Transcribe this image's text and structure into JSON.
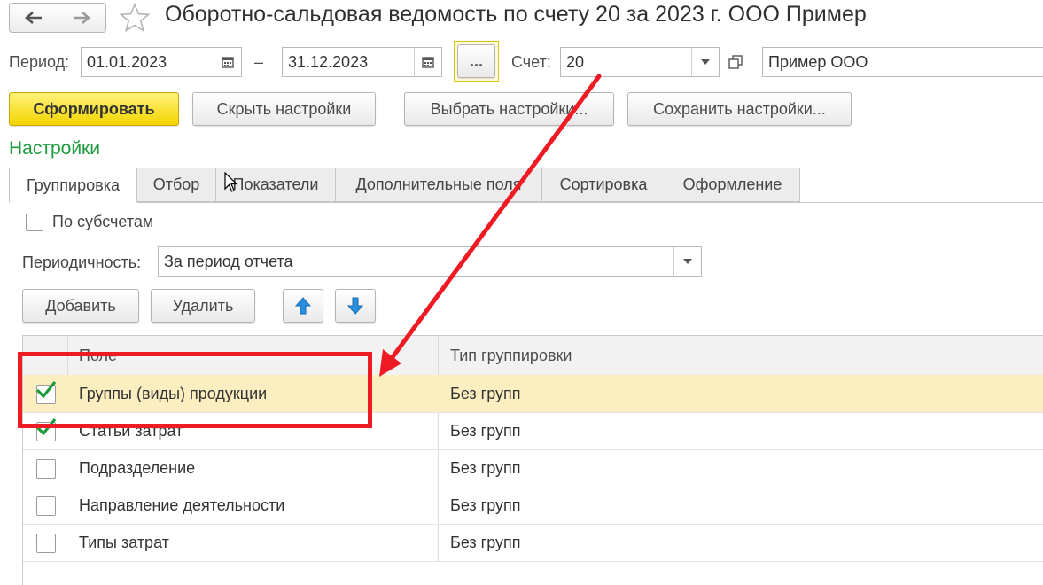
{
  "header": {
    "title": "Оборотно-сальдовая ведомость по счету 20 за 2023 г. ООО Пример"
  },
  "period": {
    "label": "Период:",
    "from": "01.01.2023",
    "dash": "–",
    "to": "31.12.2023",
    "more_label": "..."
  },
  "account": {
    "label": "Счет:",
    "value": "20",
    "org": "Пример ООО"
  },
  "toolbar": {
    "generate": "Сформировать",
    "hide_settings": "Скрыть настройки",
    "choose_settings": "Выбрать настройки...",
    "save_settings": "Сохранить настройки..."
  },
  "settings": {
    "title": "Настройки",
    "tabs": [
      {
        "label": "Группировка"
      },
      {
        "label": "Отбор"
      },
      {
        "label": "Показатели"
      },
      {
        "label": "Дополнительные поля"
      },
      {
        "label": "Сортировка"
      },
      {
        "label": "Оформление"
      }
    ],
    "subaccounts_label": "По субсчетам",
    "periodicity_label": "Периодичность:",
    "periodicity_value": "За период отчета",
    "add": "Добавить",
    "delete": "Удалить"
  },
  "table": {
    "headers": {
      "field": "Поле",
      "type": "Тип группировки"
    },
    "rows": [
      {
        "field": "Группы (виды) продукции",
        "type": "Без групп",
        "checked": true
      },
      {
        "field": "Статьи затрат",
        "type": "Без групп",
        "checked": true
      },
      {
        "field": "Подразделение",
        "type": "Без групп",
        "checked": false
      },
      {
        "field": "Направление деятельности",
        "type": "Без групп",
        "checked": false
      },
      {
        "field": "Типы затрат",
        "type": "Без групп",
        "checked": false
      }
    ]
  },
  "colors": {
    "accent_green": "#1e9b3e",
    "primary_button": "#f2d500",
    "selected_row": "#fbeec0",
    "annotation_red": "#ee1b24"
  },
  "icons": [
    "back-arrow-icon",
    "forward-arrow-icon",
    "star-icon",
    "calendar-icon",
    "dropdown-icon",
    "open-icon",
    "move-up-icon",
    "move-down-icon",
    "checkmark-icon"
  ]
}
